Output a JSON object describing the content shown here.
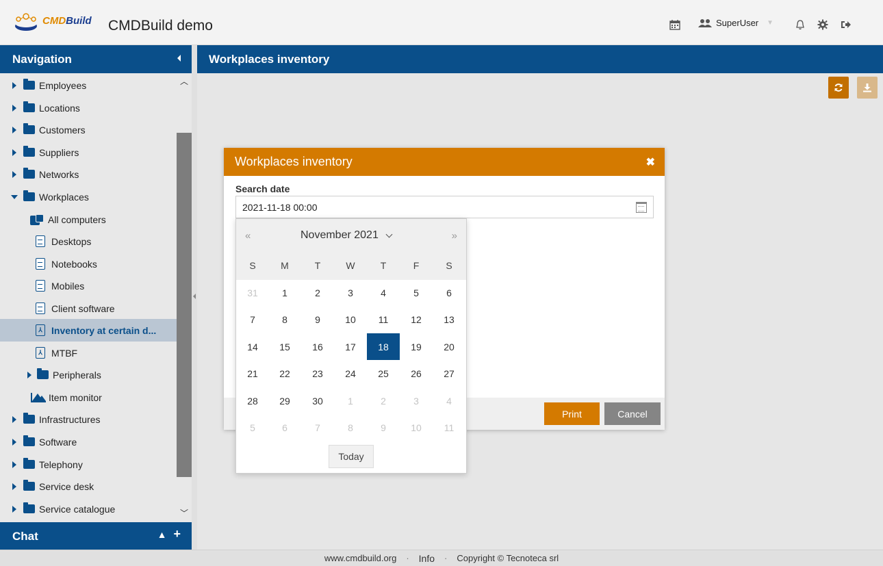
{
  "header": {
    "logo_text_cmd": "CMD",
    "logo_text_build": "Build",
    "app_title": "CMDBuild demo",
    "user_name": "SuperUser"
  },
  "navigation": {
    "title": "Navigation",
    "items": [
      {
        "label": "Employees"
      },
      {
        "label": "Locations"
      },
      {
        "label": "Customers"
      },
      {
        "label": "Suppliers"
      },
      {
        "label": "Networks"
      },
      {
        "label": "Workplaces"
      },
      {
        "label": "All computers"
      },
      {
        "label": "Desktops"
      },
      {
        "label": "Notebooks"
      },
      {
        "label": "Mobiles"
      },
      {
        "label": "Client software"
      },
      {
        "label": "Inventory at certain d..."
      },
      {
        "label": "MTBF"
      },
      {
        "label": "Peripherals"
      },
      {
        "label": "Item monitor"
      },
      {
        "label": "Infrastructures"
      },
      {
        "label": "Software"
      },
      {
        "label": "Telephony"
      },
      {
        "label": "Service desk"
      },
      {
        "label": "Service catalogue"
      }
    ]
  },
  "chat": {
    "title": "Chat"
  },
  "main": {
    "title": "Workplaces inventory"
  },
  "dialog": {
    "title": "Workplaces inventory",
    "field_label": "Search date",
    "field_value": "2021-11-18 00:00",
    "print_label": "Print",
    "cancel_label": "Cancel"
  },
  "datepicker": {
    "month_label": "November 2021",
    "weekdays": [
      "S",
      "M",
      "T",
      "W",
      "T",
      "F",
      "S"
    ],
    "weeks": [
      [
        "31",
        "1",
        "2",
        "3",
        "4",
        "5",
        "6"
      ],
      [
        "7",
        "8",
        "9",
        "10",
        "11",
        "12",
        "13"
      ],
      [
        "14",
        "15",
        "16",
        "17",
        "18",
        "19",
        "20"
      ],
      [
        "21",
        "22",
        "23",
        "24",
        "25",
        "26",
        "27"
      ],
      [
        "28",
        "29",
        "30",
        "1",
        "2",
        "3",
        "4"
      ],
      [
        "5",
        "6",
        "7",
        "8",
        "9",
        "10",
        "11"
      ]
    ],
    "selected_day": "18",
    "today_label": "Today"
  },
  "footer": {
    "site": "www.cmdbuild.org",
    "info": "Info",
    "copyright": "Copyright © Tecnoteca srl"
  },
  "colors": {
    "primary": "#0a4f8a",
    "accent": "#d47a00"
  }
}
